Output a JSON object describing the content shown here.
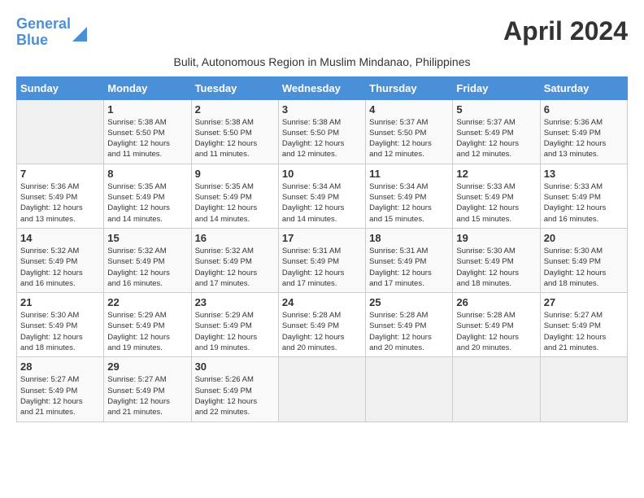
{
  "header": {
    "logo_line1": "General",
    "logo_line2": "Blue",
    "month": "April 2024",
    "subtitle": "Bulit, Autonomous Region in Muslim Mindanao, Philippines"
  },
  "days_of_week": [
    "Sunday",
    "Monday",
    "Tuesday",
    "Wednesday",
    "Thursday",
    "Friday",
    "Saturday"
  ],
  "weeks": [
    [
      {
        "day": "",
        "info": ""
      },
      {
        "day": "1",
        "info": "Sunrise: 5:38 AM\nSunset: 5:50 PM\nDaylight: 12 hours\nand 11 minutes."
      },
      {
        "day": "2",
        "info": "Sunrise: 5:38 AM\nSunset: 5:50 PM\nDaylight: 12 hours\nand 11 minutes."
      },
      {
        "day": "3",
        "info": "Sunrise: 5:38 AM\nSunset: 5:50 PM\nDaylight: 12 hours\nand 12 minutes."
      },
      {
        "day": "4",
        "info": "Sunrise: 5:37 AM\nSunset: 5:50 PM\nDaylight: 12 hours\nand 12 minutes."
      },
      {
        "day": "5",
        "info": "Sunrise: 5:37 AM\nSunset: 5:49 PM\nDaylight: 12 hours\nand 12 minutes."
      },
      {
        "day": "6",
        "info": "Sunrise: 5:36 AM\nSunset: 5:49 PM\nDaylight: 12 hours\nand 13 minutes."
      }
    ],
    [
      {
        "day": "7",
        "info": "Sunrise: 5:36 AM\nSunset: 5:49 PM\nDaylight: 12 hours\nand 13 minutes."
      },
      {
        "day": "8",
        "info": "Sunrise: 5:35 AM\nSunset: 5:49 PM\nDaylight: 12 hours\nand 14 minutes."
      },
      {
        "day": "9",
        "info": "Sunrise: 5:35 AM\nSunset: 5:49 PM\nDaylight: 12 hours\nand 14 minutes."
      },
      {
        "day": "10",
        "info": "Sunrise: 5:34 AM\nSunset: 5:49 PM\nDaylight: 12 hours\nand 14 minutes."
      },
      {
        "day": "11",
        "info": "Sunrise: 5:34 AM\nSunset: 5:49 PM\nDaylight: 12 hours\nand 15 minutes."
      },
      {
        "day": "12",
        "info": "Sunrise: 5:33 AM\nSunset: 5:49 PM\nDaylight: 12 hours\nand 15 minutes."
      },
      {
        "day": "13",
        "info": "Sunrise: 5:33 AM\nSunset: 5:49 PM\nDaylight: 12 hours\nand 16 minutes."
      }
    ],
    [
      {
        "day": "14",
        "info": "Sunrise: 5:32 AM\nSunset: 5:49 PM\nDaylight: 12 hours\nand 16 minutes."
      },
      {
        "day": "15",
        "info": "Sunrise: 5:32 AM\nSunset: 5:49 PM\nDaylight: 12 hours\nand 16 minutes."
      },
      {
        "day": "16",
        "info": "Sunrise: 5:32 AM\nSunset: 5:49 PM\nDaylight: 12 hours\nand 17 minutes."
      },
      {
        "day": "17",
        "info": "Sunrise: 5:31 AM\nSunset: 5:49 PM\nDaylight: 12 hours\nand 17 minutes."
      },
      {
        "day": "18",
        "info": "Sunrise: 5:31 AM\nSunset: 5:49 PM\nDaylight: 12 hours\nand 17 minutes."
      },
      {
        "day": "19",
        "info": "Sunrise: 5:30 AM\nSunset: 5:49 PM\nDaylight: 12 hours\nand 18 minutes."
      },
      {
        "day": "20",
        "info": "Sunrise: 5:30 AM\nSunset: 5:49 PM\nDaylight: 12 hours\nand 18 minutes."
      }
    ],
    [
      {
        "day": "21",
        "info": "Sunrise: 5:30 AM\nSunset: 5:49 PM\nDaylight: 12 hours\nand 18 minutes."
      },
      {
        "day": "22",
        "info": "Sunrise: 5:29 AM\nSunset: 5:49 PM\nDaylight: 12 hours\nand 19 minutes."
      },
      {
        "day": "23",
        "info": "Sunrise: 5:29 AM\nSunset: 5:49 PM\nDaylight: 12 hours\nand 19 minutes."
      },
      {
        "day": "24",
        "info": "Sunrise: 5:28 AM\nSunset: 5:49 PM\nDaylight: 12 hours\nand 20 minutes."
      },
      {
        "day": "25",
        "info": "Sunrise: 5:28 AM\nSunset: 5:49 PM\nDaylight: 12 hours\nand 20 minutes."
      },
      {
        "day": "26",
        "info": "Sunrise: 5:28 AM\nSunset: 5:49 PM\nDaylight: 12 hours\nand 20 minutes."
      },
      {
        "day": "27",
        "info": "Sunrise: 5:27 AM\nSunset: 5:49 PM\nDaylight: 12 hours\nand 21 minutes."
      }
    ],
    [
      {
        "day": "28",
        "info": "Sunrise: 5:27 AM\nSunset: 5:49 PM\nDaylight: 12 hours\nand 21 minutes."
      },
      {
        "day": "29",
        "info": "Sunrise: 5:27 AM\nSunset: 5:49 PM\nDaylight: 12 hours\nand 21 minutes."
      },
      {
        "day": "30",
        "info": "Sunrise: 5:26 AM\nSunset: 5:49 PM\nDaylight: 12 hours\nand 22 minutes."
      },
      {
        "day": "",
        "info": ""
      },
      {
        "day": "",
        "info": ""
      },
      {
        "day": "",
        "info": ""
      },
      {
        "day": "",
        "info": ""
      }
    ]
  ]
}
